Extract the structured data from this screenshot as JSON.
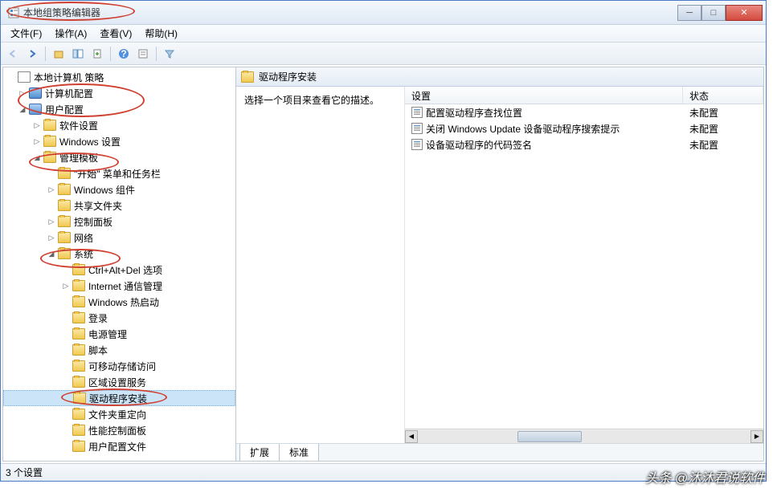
{
  "window": {
    "title": "本地组策略编辑器"
  },
  "menu": {
    "file": "文件(F)",
    "action": "操作(A)",
    "view": "查看(V)",
    "help": "帮助(H)"
  },
  "tree": {
    "root": "本地计算机 策略",
    "computer_config": "计算机配置",
    "user_config": "用户配置",
    "software_settings": "软件设置",
    "windows_settings": "Windows 设置",
    "admin_templates": "管理模板",
    "start_menu": "\"开始\" 菜单和任务栏",
    "windows_components": "Windows 组件",
    "shared_folders": "共享文件夹",
    "control_panel": "控制面板",
    "network": "网络",
    "system": "系统",
    "ctrl_alt_del": "Ctrl+Alt+Del 选项",
    "internet_comm": "Internet 通信管理",
    "windows_hotstart": "Windows 热启动",
    "login": "登录",
    "power_mgmt": "电源管理",
    "scripts": "脚本",
    "removable_storage": "可移动存储访问",
    "locale_services": "区域设置服务",
    "driver_install": "驱动程序安装",
    "folder_redirect": "文件夹重定向",
    "perf_ctrl_panel": "性能控制面板",
    "user_config_files": "用户配置文件"
  },
  "right": {
    "title": "驱动程序安装",
    "desc": "选择一个项目来查看它的描述。",
    "columns": {
      "setting": "设置",
      "state": "状态"
    },
    "rows": [
      {
        "name": "配置驱动程序查找位置",
        "state": "未配置"
      },
      {
        "name": "关闭 Windows Update 设备驱动程序搜索提示",
        "state": "未配置"
      },
      {
        "name": "设备驱动程序的代码签名",
        "state": "未配置"
      }
    ]
  },
  "tabs": {
    "extended": "扩展",
    "standard": "标准"
  },
  "status": "3 个设置",
  "watermark": "头条 @沐沐君说软件"
}
